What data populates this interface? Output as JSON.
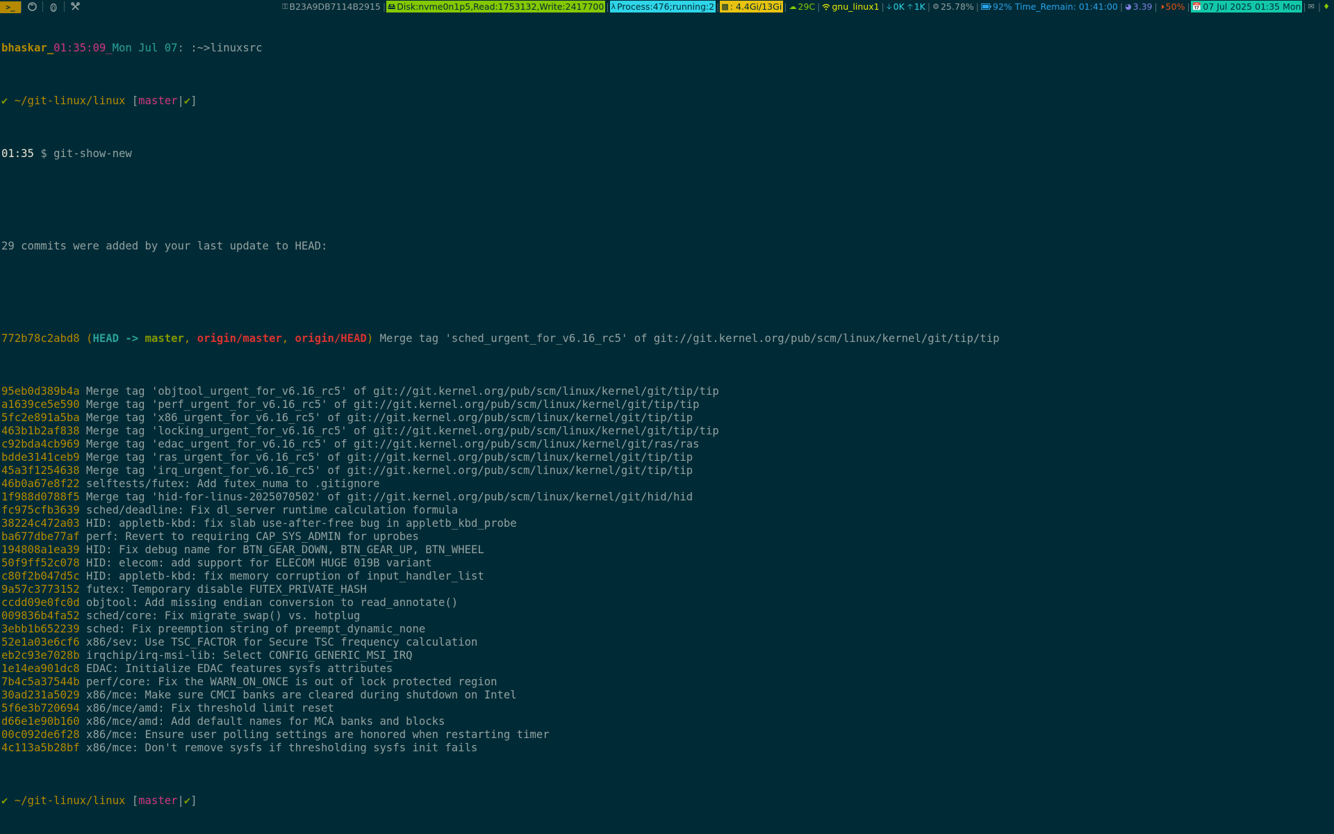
{
  "topbar": {
    "launchers": [
      "terminal-launcher",
      "firefox-launcher",
      "penguin-launcher",
      "tools-launcher"
    ],
    "key_id": "B23A9DB7114B2915",
    "disk": "Disk:nvme0n1p5,Read:1753132,Write:2417700",
    "process": "Process:476;running:2",
    "memory": ": 4.4Gi/13Gi",
    "temp": "29C",
    "wifi": "gnu_linux1",
    "net_down": "0K",
    "net_up": "1K",
    "cpu": "25.78%",
    "battery": "92% Time_Remain: 01:41:00",
    "load": "3.39",
    "volume": "50%",
    "date": "07 Jul 2025 01:35 Mon",
    "colors": {
      "bg": "#002b36",
      "disk_bg": "#85c800",
      "process_bg": "#2fd5e8",
      "memory_bg": "#e8c310",
      "date_bg": "#12c8a8",
      "key_fg": "#93a1a1",
      "temp_fg": "#85c800",
      "wifi_fg": "#e8e800",
      "net_fg": "#2fd5e8",
      "cpu_fg": "#93a1a1",
      "battery_fg": "#2aa1e8",
      "load_fg": "#8080e0",
      "volume_fg": "#e85010"
    }
  },
  "terminal": {
    "prompt_header": {
      "user": "bhaskar_",
      "time": "01:35:09_",
      "day": "Mon Jul 07",
      "separator": ": ",
      "path": ":~>linuxsrc"
    },
    "prompt": {
      "check": "✔",
      "dir": " ~/git-linux/linux ",
      "bracket_open": "[",
      "branch": "master",
      "pipe": "|",
      "ok": "✔",
      "bracket_close": "]"
    },
    "prompt_time": "01:35",
    "dollar": " $ ",
    "command": "git-show-new",
    "summary": "29 commits were added by your last update to HEAD:",
    "head_commit": {
      "hash": "772b78c2abd8",
      "paren_open": " (",
      "head": "HEAD -> ",
      "master": "master",
      "comma1": ", ",
      "origin_master": "origin/master",
      "comma2": ", ",
      "origin_head": "origin/HEAD",
      "paren_close": ")",
      "message": " Merge tag 'sched_urgent_for_v6.16_rc5' of git://git.kernel.org/pub/scm/linux/kernel/git/tip/tip"
    },
    "commits": [
      {
        "hash": "95eb0d389b4a",
        "message": " Merge tag 'objtool_urgent_for_v6.16_rc5' of git://git.kernel.org/pub/scm/linux/kernel/git/tip/tip"
      },
      {
        "hash": "a1639ce5e590",
        "message": " Merge tag 'perf_urgent_for_v6.16_rc5' of git://git.kernel.org/pub/scm/linux/kernel/git/tip/tip"
      },
      {
        "hash": "5fc2e891a5ba",
        "message": " Merge tag 'x86_urgent_for_v6.16_rc5' of git://git.kernel.org/pub/scm/linux/kernel/git/tip/tip"
      },
      {
        "hash": "463b1b2af838",
        "message": " Merge tag 'locking_urgent_for_v6.16_rc5' of git://git.kernel.org/pub/scm/linux/kernel/git/tip/tip"
      },
      {
        "hash": "c92bda4cb969",
        "message": " Merge tag 'edac_urgent_for_v6.16_rc5' of git://git.kernel.org/pub/scm/linux/kernel/git/ras/ras"
      },
      {
        "hash": "bdde3141ceb9",
        "message": " Merge tag 'ras_urgent_for_v6.16_rc5' of git://git.kernel.org/pub/scm/linux/kernel/git/tip/tip"
      },
      {
        "hash": "45a3f1254638",
        "message": " Merge tag 'irq_urgent_for_v6.16_rc5' of git://git.kernel.org/pub/scm/linux/kernel/git/tip/tip"
      },
      {
        "hash": "46b0a67e8f22",
        "message": " selftests/futex: Add futex_numa to .gitignore"
      },
      {
        "hash": "1f988d0788f5",
        "message": " Merge tag 'hid-for-linus-2025070502' of git://git.kernel.org/pub/scm/linux/kernel/git/hid/hid"
      },
      {
        "hash": "fc975cfb3639",
        "message": " sched/deadline: Fix dl_server runtime calculation formula"
      },
      {
        "hash": "38224c472a03",
        "message": " HID: appletb-kbd: fix slab use-after-free bug in appletb_kbd_probe"
      },
      {
        "hash": "ba677dbe77af",
        "message": " perf: Revert to requiring CAP_SYS_ADMIN for uprobes"
      },
      {
        "hash": "194808a1ea39",
        "message": " HID: Fix debug name for BTN_GEAR_DOWN, BTN_GEAR_UP, BTN_WHEEL"
      },
      {
        "hash": "50f9ff52c078",
        "message": " HID: elecom: add support for ELECOM HUGE 019B variant"
      },
      {
        "hash": "c80f2b047d5c",
        "message": " HID: appletb-kbd: fix memory corruption of input_handler_list"
      },
      {
        "hash": "9a57c3773152",
        "message": " futex: Temporary disable FUTEX_PRIVATE_HASH"
      },
      {
        "hash": "ccdd09e0fc0d",
        "message": " objtool: Add missing endian conversion to read_annotate()"
      },
      {
        "hash": "009836b4fa52",
        "message": " sched/core: Fix migrate_swap() vs. hotplug"
      },
      {
        "hash": "3ebb1b652239",
        "message": " sched: Fix preemption string of preempt_dynamic_none"
      },
      {
        "hash": "52e1a03e6cf6",
        "message": " x86/sev: Use TSC_FACTOR for Secure TSC frequency calculation"
      },
      {
        "hash": "eb2c93e7028b",
        "message": " irqchip/irq-msi-lib: Select CONFIG_GENERIC_MSI_IRQ"
      },
      {
        "hash": "1e14ea901dc8",
        "message": " EDAC: Initialize EDAC features sysfs attributes"
      },
      {
        "hash": "7b4c5a37544b",
        "message": " perf/core: Fix the WARN_ON_ONCE is out of lock protected region"
      },
      {
        "hash": "30ad231a5029",
        "message": " x86/mce: Make sure CMCI banks are cleared during shutdown on Intel"
      },
      {
        "hash": "5f6e3b720694",
        "message": " x86/mce/amd: Fix threshold limit reset"
      },
      {
        "hash": "d66e1e90b160",
        "message": " x86/mce/amd: Add default names for MCA banks and blocks"
      },
      {
        "hash": "00c092de6f28",
        "message": " x86/mce: Ensure user polling settings are honored when restarting timer"
      },
      {
        "hash": "4c113a5b28bf",
        "message": " x86/mce: Don't remove sysfs if thresholding sysfs init fails"
      }
    ]
  }
}
